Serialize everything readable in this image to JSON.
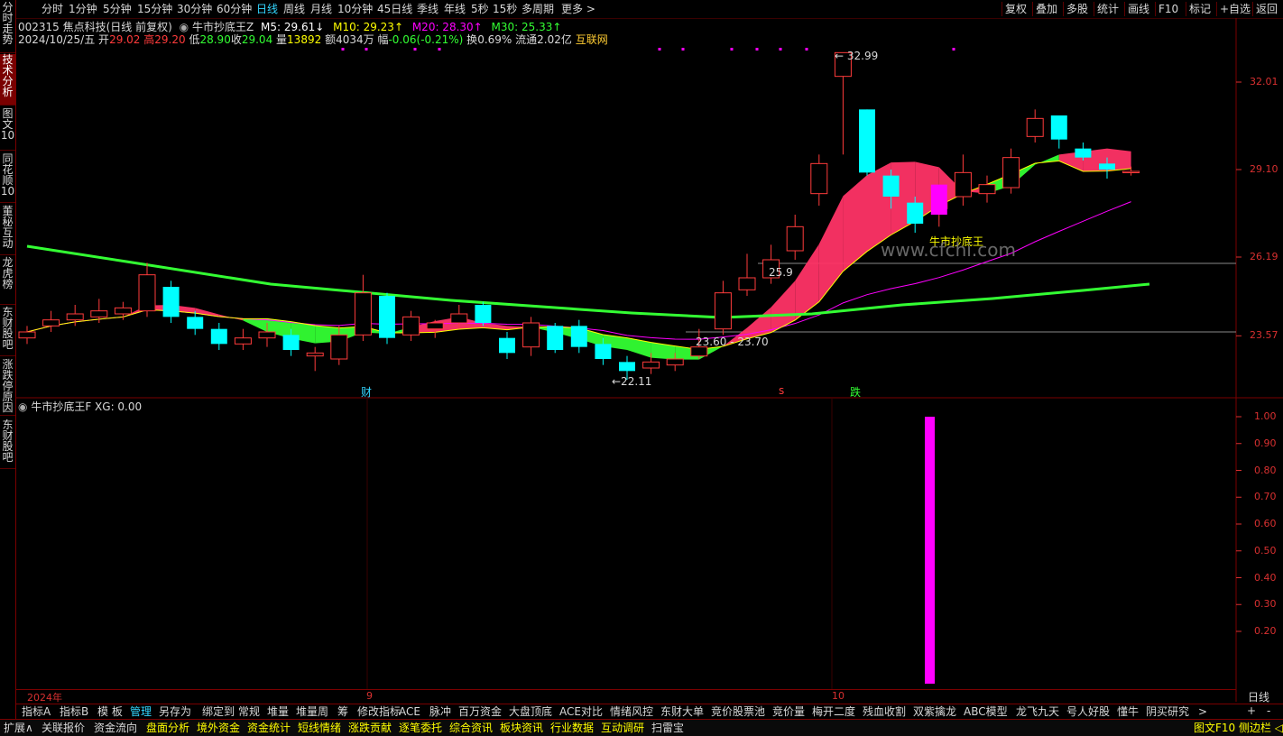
{
  "periods": [
    "分时",
    "1分钟",
    "5分钟",
    "15分钟",
    "30分钟",
    "60分钟",
    "日线",
    "周线",
    "月线",
    "10分钟",
    "45日线",
    "季线",
    "年线",
    "5秒",
    "15秒",
    "多周期",
    "更多 >"
  ],
  "active_period": "日线",
  "tools": [
    "复权",
    "叠加",
    "多股",
    "统计",
    "画线",
    "F10",
    "标记",
    "+自选",
    "返回"
  ],
  "sidebar": [
    "分时走势",
    "技术分析",
    "图文10",
    "同花顺10",
    "董秘互动",
    "龙虎榜",
    "东财股吧",
    "涨跌停原因",
    "东财股吧"
  ],
  "stock": {
    "code_name": "002315 焦点科技(日线 前复权)",
    "date": "2024/10/25/五",
    "open_label": "开",
    "open": "29.02",
    "high_label": "高",
    "high": "29.20",
    "low_label": "低",
    "low": "28.90",
    "close_label": "收",
    "close": "29.04",
    "vol_label": "量",
    "vol": "13892",
    "amount_label": "额",
    "amount": "4034万",
    "chg_label": "幅",
    "chg": "-0.06(-0.21%)",
    "turn_label": "换",
    "turn": "0.69%",
    "float_label": "流通",
    "float": "2.02亿",
    "concept": "互联网"
  },
  "indicator_main": {
    "name": "牛市抄底王Z",
    "ma5": "M5: 29.61↓",
    "ma10": "M10: 29.23↑",
    "ma20": "M20: 28.30↑",
    "ma30": "M30: 25.33↑",
    "label": "牛市抄底王",
    "watermark": "www.cfchi.com"
  },
  "indicator_sub": {
    "name": "牛市抄底王F",
    "value": "XG: 0.00"
  },
  "price_axis": [
    "32.01",
    "29.10",
    "26.19",
    "23.57"
  ],
  "sub_axis": [
    "1.00",
    "0.90",
    "0.80",
    "0.70",
    "0.60",
    "0.50",
    "0.40",
    "0.30",
    "0.20"
  ],
  "annotations": {
    "high": "32.99",
    "low": "←22.11",
    "mid1": "23.60",
    "mid2": "23.70",
    "mid3": "25.9",
    "mark_cai": "财",
    "mark_s": "s",
    "mark_die": "跌"
  },
  "date_axis": [
    "2024年",
    "9",
    "10"
  ],
  "timeframe_label": "日线",
  "buttons": [
    "指标A",
    "指标B",
    "模 板",
    "管理",
    "另存为",
    "绑定到",
    "常规",
    "堆量",
    "堆量周",
    "筹",
    "修改指标",
    "ACE",
    "脉冲",
    "百万资金",
    "大盘顶底",
    "ACE对比",
    "情绪风控",
    "东财大单",
    "竞价股票池",
    "竞价量",
    "梅开二度",
    "残血收割",
    "双紫擒龙",
    "ABC模型",
    "龙飞九天",
    "号人好股",
    "懂牛",
    "阴买研究",
    ">"
  ],
  "active_button": "管理",
  "bottom": [
    "扩展∧",
    "关联报价",
    "资金流向",
    "盘面分析",
    "境外资金",
    "资金统计",
    "短线情绪",
    "涨跌贡献",
    "逐笔委托",
    "综合资讯",
    "板块资讯",
    "行业数据",
    "互动调研",
    "扫雷宝"
  ],
  "bottom_right": "图文F10 侧边栏 ◁",
  "colors": {
    "up": "#ff3b3b",
    "down": "#00ffff",
    "green_line": "#33ff33",
    "pink": "#ff3366",
    "magenta": "#ff00ff",
    "yellow": "#ffff00",
    "dark_red": "#7a0000"
  },
  "chart_data": {
    "type": "candlestick",
    "candles": [
      {
        "o": 23.5,
        "c": 23.7,
        "h": 23.9,
        "l": 23.3
      },
      {
        "o": 23.9,
        "c": 24.1,
        "h": 24.4,
        "l": 23.7
      },
      {
        "o": 24.1,
        "c": 24.3,
        "h": 24.6,
        "l": 23.9
      },
      {
        "o": 24.2,
        "c": 24.4,
        "h": 24.8,
        "l": 24.0
      },
      {
        "o": 24.3,
        "c": 24.5,
        "h": 24.7,
        "l": 24.1
      },
      {
        "o": 24.4,
        "c": 25.6,
        "h": 26.0,
        "l": 24.2
      },
      {
        "o": 25.2,
        "c": 24.2,
        "h": 25.4,
        "l": 24.0
      },
      {
        "o": 24.2,
        "c": 23.8,
        "h": 24.4,
        "l": 23.6
      },
      {
        "o": 23.8,
        "c": 23.3,
        "h": 24.0,
        "l": 23.1
      },
      {
        "o": 23.3,
        "c": 23.5,
        "h": 23.8,
        "l": 23.1
      },
      {
        "o": 23.5,
        "c": 23.7,
        "h": 24.0,
        "l": 23.2
      },
      {
        "o": 23.6,
        "c": 23.1,
        "h": 23.8,
        "l": 22.9
      },
      {
        "o": 22.9,
        "c": 23.0,
        "h": 23.2,
        "l": 22.4
      },
      {
        "o": 22.8,
        "c": 23.6,
        "h": 23.9,
        "l": 22.6
      },
      {
        "o": 23.6,
        "c": 25.0,
        "h": 25.6,
        "l": 23.4
      },
      {
        "o": 24.9,
        "c": 23.5,
        "h": 25.0,
        "l": 23.3
      },
      {
        "o": 23.6,
        "c": 24.2,
        "h": 24.4,
        "l": 23.4
      },
      {
        "o": 23.8,
        "c": 24.0,
        "h": 24.1,
        "l": 23.5
      },
      {
        "o": 24.0,
        "c": 24.3,
        "h": 24.6,
        "l": 23.8
      },
      {
        "o": 24.6,
        "c": 24.0,
        "h": 24.7,
        "l": 23.9
      },
      {
        "o": 23.5,
        "c": 23.0,
        "h": 23.7,
        "l": 22.8
      },
      {
        "o": 23.2,
        "c": 24.0,
        "h": 24.2,
        "l": 22.9
      },
      {
        "o": 23.9,
        "c": 23.1,
        "h": 24.0,
        "l": 23.0
      },
      {
        "o": 23.9,
        "c": 23.2,
        "h": 24.1,
        "l": 23.0
      },
      {
        "o": 23.3,
        "c": 22.8,
        "h": 23.5,
        "l": 22.6
      },
      {
        "o": 22.7,
        "c": 22.4,
        "h": 22.9,
        "l": 22.11
      },
      {
        "o": 22.5,
        "c": 22.7,
        "h": 23.0,
        "l": 22.3
      },
      {
        "o": 22.6,
        "c": 22.8,
        "h": 23.0,
        "l": 22.4
      },
      {
        "o": 22.9,
        "c": 23.2,
        "h": 23.8,
        "l": 22.8
      },
      {
        "o": 23.8,
        "c": 25.0,
        "h": 25.4,
        "l": 23.6
      },
      {
        "o": 25.1,
        "c": 25.5,
        "h": 26.3,
        "l": 24.9
      },
      {
        "o": 25.5,
        "c": 26.1,
        "h": 26.6,
        "l": 25.3
      },
      {
        "o": 26.4,
        "c": 27.2,
        "h": 27.6,
        "l": 26.1
      },
      {
        "o": 28.3,
        "c": 29.3,
        "h": 29.6,
        "l": 27.9
      },
      {
        "o": 32.2,
        "c": 32.99,
        "h": 32.99,
        "l": 29.6
      },
      {
        "o": 31.1,
        "c": 29.0,
        "h": 31.1,
        "l": 28.9
      },
      {
        "o": 28.9,
        "c": 28.2,
        "h": 29.1,
        "l": 27.8
      },
      {
        "o": 28.0,
        "c": 27.3,
        "h": 28.2,
        "l": 27.0
      },
      {
        "o": 27.8,
        "c": 28.4,
        "h": 28.5,
        "l": 27.2
      },
      {
        "o": 28.2,
        "c": 29.0,
        "h": 29.6,
        "l": 27.9
      },
      {
        "o": 28.3,
        "c": 28.6,
        "h": 28.9,
        "l": 28.0
      },
      {
        "o": 28.5,
        "c": 29.5,
        "h": 29.8,
        "l": 28.3
      },
      {
        "o": 30.2,
        "c": 30.8,
        "h": 31.1,
        "l": 30.0
      },
      {
        "o": 30.9,
        "c": 30.1,
        "h": 30.9,
        "l": 29.8
      },
      {
        "o": 29.8,
        "c": 29.5,
        "h": 30.0,
        "l": 29.4
      },
      {
        "o": 29.3,
        "c": 29.1,
        "h": 29.5,
        "l": 28.8
      },
      {
        "o": 29.02,
        "c": 29.04,
        "h": 29.2,
        "l": 28.9
      }
    ],
    "sub_signal": {
      "type": "bar",
      "value": 1.0
    }
  }
}
